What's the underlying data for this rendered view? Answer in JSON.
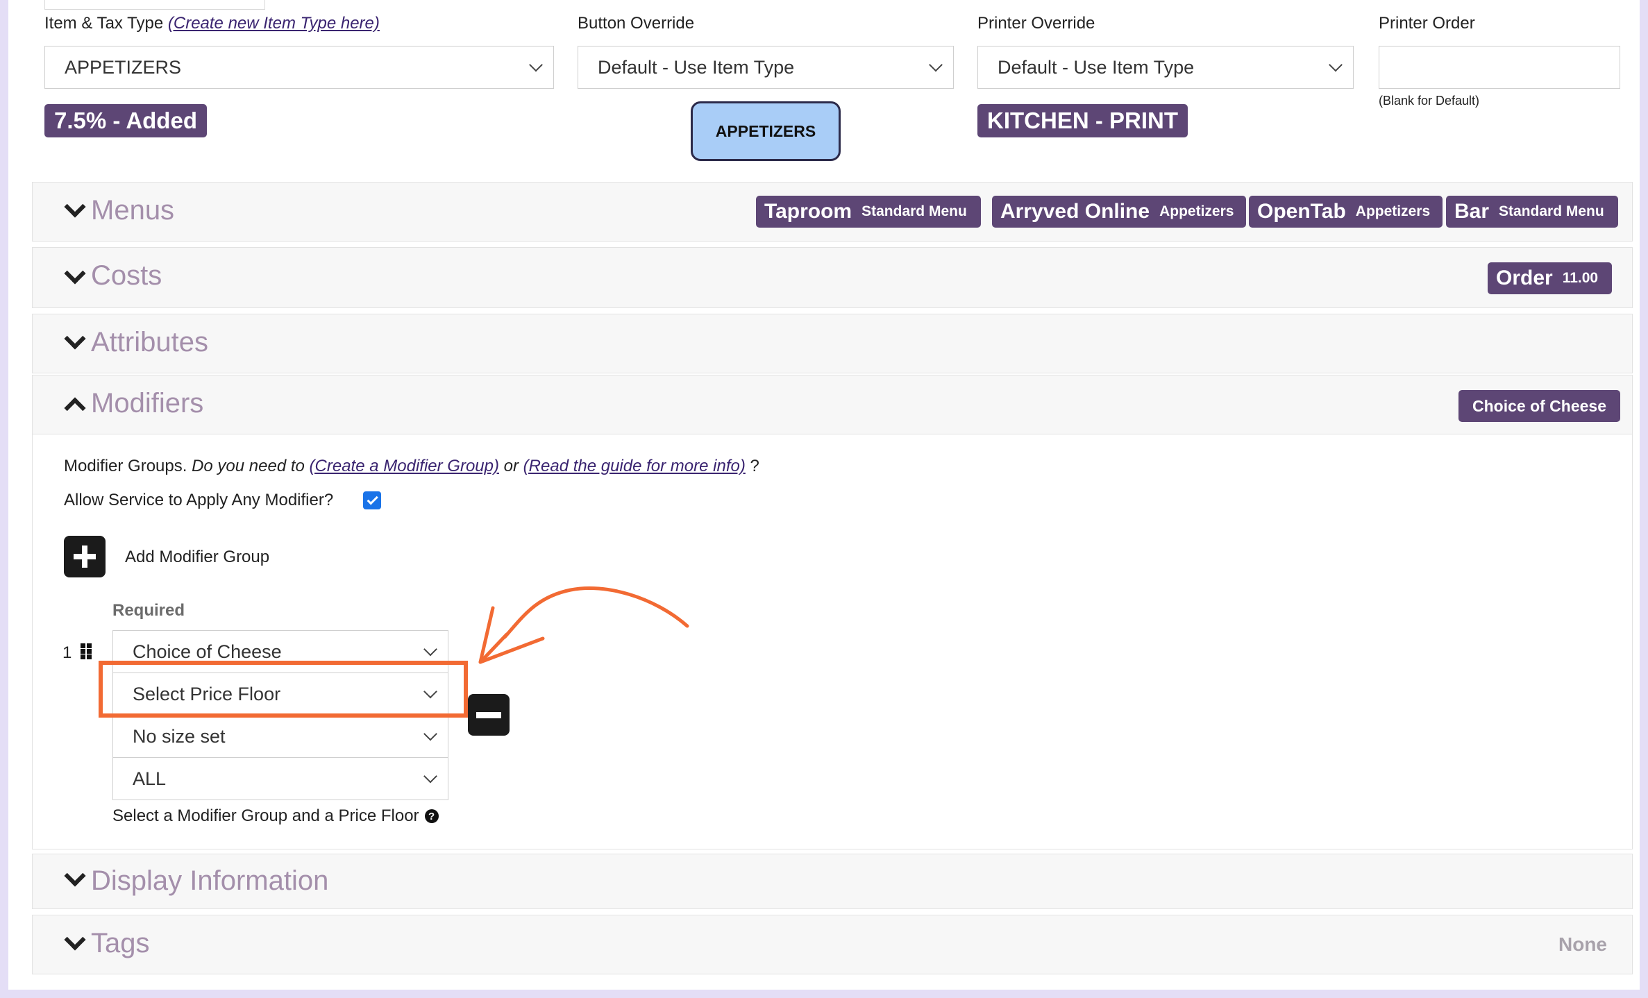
{
  "top": {
    "item_tax_label": "Item & Tax Type",
    "item_tax_link": "(Create new Item Type here)",
    "item_tax_value": "APPETIZERS",
    "tax_badge": "7.5% - Added",
    "button_override_label": "Button Override",
    "button_override_value": "Default - Use Item Type",
    "button_preview": "APPETIZERS",
    "printer_override_label": "Printer Override",
    "printer_override_value": "Default - Use Item Type",
    "printer_badge": "KITCHEN - PRINT",
    "printer_order_label": "Printer Order",
    "printer_order_value": "",
    "printer_order_hint": "(Blank for Default)"
  },
  "sections": {
    "menus": {
      "title": "Menus",
      "badges": [
        {
          "name": "Taproom",
          "detail": "Standard Menu"
        },
        {
          "name": "Arryved Online",
          "detail": "Appetizers"
        },
        {
          "name": "OpenTab",
          "detail": "Appetizers"
        },
        {
          "name": "Bar",
          "detail": "Standard Menu"
        }
      ]
    },
    "costs": {
      "title": "Costs",
      "badge_name": "Order",
      "badge_value": "11.00"
    },
    "attributes": {
      "title": "Attributes"
    },
    "modifiers": {
      "title": "Modifiers",
      "badge": "Choice of Cheese",
      "intro_text": "Modifier Groups.",
      "intro_question": "Do you need to",
      "create_link": "(Create a Modifier Group)",
      "or_text": "or",
      "guide_link": "(Read the guide for more info)",
      "end_mark": "?",
      "allow_label": "Allow Service to Apply Any Modifier?",
      "allow_checked": true,
      "add_group_label": "Add Modifier Group",
      "required_label": "Required",
      "row_number": "1",
      "group_select": "Choice of Cheese",
      "price_floor_select": "Select Price Floor",
      "size_select": "No size set",
      "scope_select": "ALL",
      "help_text": "Select a Modifier Group and a Price Floor"
    },
    "display": {
      "title": "Display Information"
    },
    "tags": {
      "title": "Tags",
      "value": "None"
    }
  },
  "colors": {
    "badge": "#5d4675",
    "section_title": "#a48fab",
    "highlight": "#f26a33",
    "button_preview_bg": "#a9cdf7"
  }
}
